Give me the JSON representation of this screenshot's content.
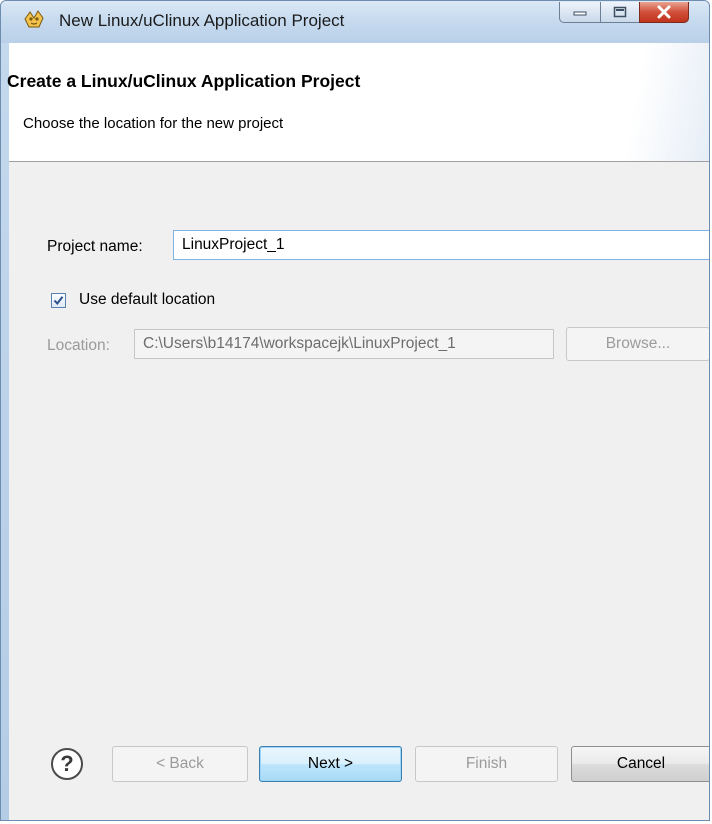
{
  "window": {
    "title": "New Linux/uClinux Application Project",
    "app_icon": "wizard-icon"
  },
  "banner": {
    "title": "Create a Linux/uClinux Application Project",
    "subtitle": "Choose the location for the new project"
  },
  "form": {
    "project_name_label": "Project name:",
    "project_name_value": "LinuxProject_1",
    "use_default_location_label": "Use default location",
    "use_default_location_checked": true,
    "location_label": "Location:",
    "location_value": "C:\\Users\\b14174\\workspacejk\\LinuxProject_1",
    "browse_label": "Browse..."
  },
  "buttons": {
    "help_glyph": "?",
    "back_label": "< Back",
    "next_label": "Next >",
    "finish_label": "Finish",
    "cancel_label": "Cancel"
  },
  "colors": {
    "title_bar": "#c7dbef",
    "dialog_background": "#f0f0f0",
    "default_button_border": "#3c7fb1",
    "close_button": "#c7442f"
  }
}
